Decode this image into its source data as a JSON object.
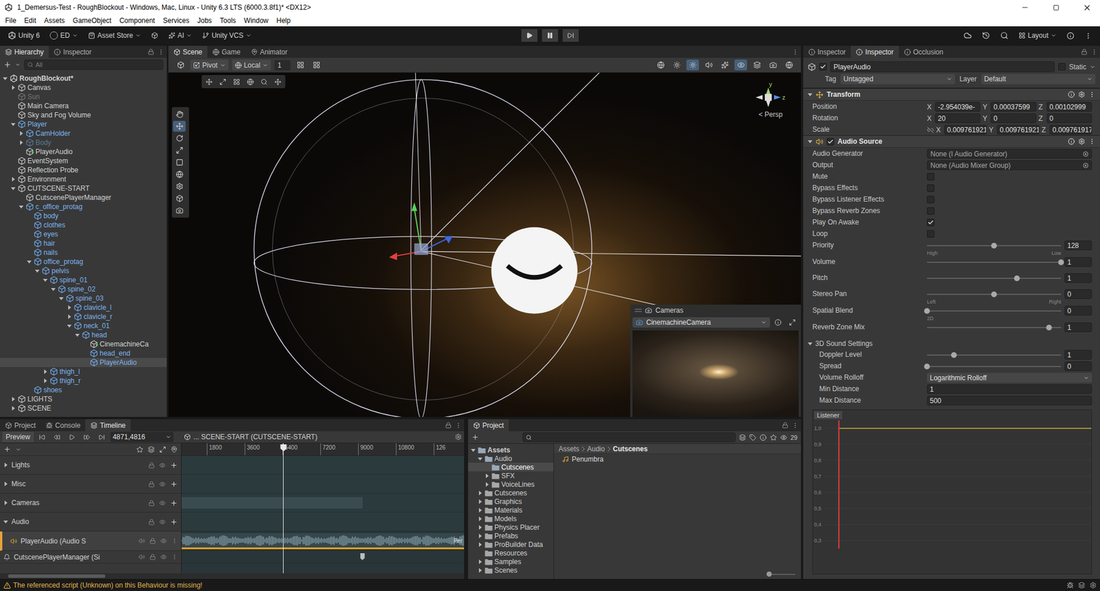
{
  "window": {
    "title": "1_Demersus-Test - RoughBlockout - Windows, Mac, Linux - Unity 6.3 LTS (6000.3.8f1)* <DX12>"
  },
  "menu": [
    "File",
    "Edit",
    "Assets",
    "GameObject",
    "Component",
    "Services",
    "Jobs",
    "Tools",
    "Window",
    "Help"
  ],
  "toolbar": {
    "account": "Unity 6",
    "user": "ED",
    "asset_store": "Asset Store",
    "ai": "AI",
    "vcs": "Unity VCS",
    "layout": "Layout",
    "playing": false,
    "paused": false
  },
  "hierarchy": {
    "tabs": [
      {
        "label": "Hierarchy",
        "selected": true
      },
      {
        "label": "Inspector",
        "selected": false
      }
    ],
    "search": {
      "placeholder": "All"
    },
    "rows": [
      {
        "label": "RoughBlockout*",
        "depth": 0,
        "kind": "scene",
        "has_children": true,
        "expanded": true,
        "selected": false,
        "disabled": false
      },
      {
        "label": "Canvas",
        "depth": 1,
        "kind": "object",
        "has_children": true,
        "expanded": false,
        "selected": false,
        "disabled": false
      },
      {
        "label": "Sun",
        "depth": 1,
        "kind": "object",
        "has_children": false,
        "expanded": false,
        "selected": false,
        "disabled": true
      },
      {
        "label": "Main Camera",
        "depth": 1,
        "kind": "object",
        "has_children": false,
        "expanded": false,
        "selected": false,
        "disabled": false
      },
      {
        "label": "Sky and Fog Volume",
        "depth": 1,
        "kind": "object",
        "has_children": false,
        "expanded": false,
        "selected": false,
        "disabled": false
      },
      {
        "label": "Player",
        "depth": 1,
        "kind": "prefab",
        "has_children": true,
        "expanded": true,
        "selected": false,
        "disabled": false
      },
      {
        "label": "CamHolder",
        "depth": 2,
        "kind": "prefab",
        "has_children": true,
        "expanded": false,
        "selected": false,
        "disabled": false
      },
      {
        "label": "Body",
        "depth": 2,
        "kind": "prefab",
        "has_children": true,
        "expanded": false,
        "selected": false,
        "disabled": true
      },
      {
        "label": "PlayerAudio",
        "depth": 2,
        "kind": "added",
        "has_children": false,
        "expanded": false,
        "selected": false,
        "disabled": false
      },
      {
        "label": "EventSystem",
        "depth": 1,
        "kind": "object",
        "has_children": false,
        "expanded": false,
        "selected": false,
        "disabled": false
      },
      {
        "label": "Reflection Probe",
        "depth": 1,
        "kind": "object",
        "has_children": false,
        "expanded": false,
        "selected": false,
        "disabled": false
      },
      {
        "label": "Environment",
        "depth": 1,
        "kind": "object",
        "has_children": true,
        "expanded": false,
        "selected": false,
        "disabled": false
      },
      {
        "label": "CUTSCENE-START",
        "depth": 1,
        "kind": "object",
        "has_children": true,
        "expanded": true,
        "selected": false,
        "disabled": false
      },
      {
        "label": "CutscenePlayerManager",
        "depth": 2,
        "kind": "object",
        "has_children": false,
        "expanded": false,
        "selected": false,
        "disabled": false
      },
      {
        "label": "c_office_protag",
        "depth": 2,
        "kind": "prefab",
        "has_children": true,
        "expanded": true,
        "selected": false,
        "disabled": false
      },
      {
        "label": "body",
        "depth": 3,
        "kind": "prefab",
        "has_children": false,
        "expanded": false,
        "selected": false,
        "disabled": false
      },
      {
        "label": "clothes",
        "depth": 3,
        "kind": "prefab",
        "has_children": false,
        "expanded": false,
        "selected": false,
        "disabled": false
      },
      {
        "label": "eyes",
        "depth": 3,
        "kind": "prefab",
        "has_children": false,
        "expanded": false,
        "selected": false,
        "disabled": false
      },
      {
        "label": "hair",
        "depth": 3,
        "kind": "prefab",
        "has_children": false,
        "expanded": false,
        "selected": false,
        "disabled": false
      },
      {
        "label": "nails",
        "depth": 3,
        "kind": "prefab",
        "has_children": false,
        "expanded": false,
        "selected": false,
        "disabled": false
      },
      {
        "label": "office_protag",
        "depth": 3,
        "kind": "prefab",
        "has_children": true,
        "expanded": true,
        "selected": false,
        "disabled": false
      },
      {
        "label": "pelvis",
        "depth": 4,
        "kind": "prefab",
        "has_children": true,
        "expanded": true,
        "selected": false,
        "disabled": false
      },
      {
        "label": "spine_01",
        "depth": 5,
        "kind": "prefab",
        "has_children": true,
        "expanded": true,
        "selected": false,
        "disabled": false
      },
      {
        "label": "spine_02",
        "depth": 6,
        "kind": "prefab",
        "has_children": true,
        "expanded": true,
        "selected": false,
        "disabled": false
      },
      {
        "label": "spine_03",
        "depth": 7,
        "kind": "prefab",
        "has_children": true,
        "expanded": true,
        "selected": false,
        "disabled": false
      },
      {
        "label": "clavicle_l",
        "depth": 8,
        "kind": "prefab",
        "has_children": true,
        "expanded": false,
        "selected": false,
        "disabled": false
      },
      {
        "label": "clavicle_r",
        "depth": 8,
        "kind": "prefab",
        "has_children": true,
        "expanded": false,
        "selected": false,
        "disabled": false
      },
      {
        "label": "neck_01",
        "depth": 8,
        "kind": "prefab",
        "has_children": true,
        "expanded": true,
        "selected": false,
        "disabled": false
      },
      {
        "label": "head",
        "depth": 9,
        "kind": "prefab",
        "has_children": true,
        "expanded": true,
        "selected": false,
        "disabled": false
      },
      {
        "label": "CinemachineCa",
        "depth": 10,
        "kind": "added",
        "has_children": false,
        "expanded": false,
        "selected": false,
        "disabled": false
      },
      {
        "label": "head_end",
        "depth": 10,
        "kind": "prefab",
        "has_children": false,
        "expanded": false,
        "selected": false,
        "disabled": false
      },
      {
        "label": "PlayerAudio",
        "depth": 10,
        "kind": "prefab",
        "has_children": false,
        "expanded": false,
        "selected": true,
        "disabled": false
      },
      {
        "label": "thigh_l",
        "depth": 5,
        "kind": "prefab",
        "has_children": true,
        "expanded": false,
        "selected": false,
        "disabled": false
      },
      {
        "label": "thigh_r",
        "depth": 5,
        "kind": "prefab",
        "has_children": true,
        "expanded": false,
        "selected": false,
        "disabled": false
      },
      {
        "label": "shoes",
        "depth": 3,
        "kind": "prefab",
        "has_children": false,
        "expanded": false,
        "selected": false,
        "disabled": false
      },
      {
        "label": "LIGHTS",
        "depth": 1,
        "kind": "object",
        "has_children": true,
        "expanded": false,
        "selected": false,
        "disabled": false
      },
      {
        "label": "SCENE",
        "depth": 1,
        "kind": "object",
        "has_children": true,
        "expanded": false,
        "selected": false,
        "disabled": false
      }
    ]
  },
  "scene": {
    "tabs": [
      {
        "label": "Scene",
        "selected": true
      },
      {
        "label": "Game",
        "selected": false
      },
      {
        "label": "Animator",
        "selected": false
      }
    ],
    "pivot": "Pivot",
    "space": "Local",
    "grid": "1",
    "axes": [
      "y",
      "z"
    ],
    "projection": "< Persp",
    "cameras_overlay": {
      "title": "Cameras",
      "camera": "CinemachineCamera"
    }
  },
  "inspector": {
    "tabs": [
      {
        "label": "Inspector",
        "selected": false
      },
      {
        "label": "Inspector",
        "selected": true
      },
      {
        "label": "Occlusion",
        "selected": false
      }
    ],
    "object": {
      "name": "PlayerAudio",
      "active": true,
      "static_label": "Static",
      "static": false,
      "tag_label": "Tag",
      "tag": "Untagged",
      "layer_label": "Layer",
      "layer": "Default"
    },
    "transform": {
      "title": "Transform",
      "expanded": true,
      "axes": [
        "X",
        "Y",
        "Z"
      ],
      "rows": [
        {
          "label": "Position",
          "x": "-2.954039e-",
          "y": "0.00037599",
          "z": "0.00102999"
        },
        {
          "label": "Rotation",
          "x": "20",
          "y": "0",
          "z": "0"
        },
        {
          "label": "Scale",
          "constrained": false,
          "x": "0.009761921",
          "y": "0.009761921",
          "z": "0.009761917"
        }
      ]
    },
    "audio_source": {
      "title": "Audio Source",
      "enabled": true,
      "expanded": true,
      "props": [
        {
          "kind": "object",
          "label": "Audio Generator",
          "value": "None (I Audio Generator)"
        },
        {
          "kind": "object",
          "label": "Output",
          "value": "None (Audio Mixer Group)"
        },
        {
          "kind": "checkbox",
          "label": "Mute",
          "checked": false
        },
        {
          "kind": "checkbox",
          "label": "Bypass Effects",
          "checked": false
        },
        {
          "kind": "checkbox",
          "label": "Bypass Listener Effects",
          "checked": false
        },
        {
          "kind": "checkbox",
          "label": "Bypass Reverb Zones",
          "checked": false
        },
        {
          "kind": "checkbox",
          "label": "Play On Awake",
          "checked": true
        },
        {
          "kind": "checkbox",
          "label": "Loop",
          "checked": false
        },
        {
          "kind": "slider",
          "label": "Priority",
          "level": 0.5,
          "value": "128",
          "min_label": "High",
          "max_label": "Low"
        },
        {
          "kind": "slider",
          "label": "Volume",
          "level": 1,
          "value": "1"
        },
        {
          "kind": "slider",
          "label": "Pitch",
          "level": 0.67,
          "value": "1"
        },
        {
          "kind": "slider",
          "label": "Stereo Pan",
          "level": 0.5,
          "value": "0",
          "min_label": "Left",
          "max_label": "Right"
        },
        {
          "kind": "slider",
          "label": "Spatial Blend",
          "level": 0,
          "value": "0",
          "min_label": "2D"
        },
        {
          "kind": "slider",
          "label": "Reverb Zone Mix",
          "level": 0.91,
          "value": "1"
        },
        {
          "kind": "section",
          "label": "3D Sound Settings",
          "expanded": true
        },
        {
          "kind": "slider",
          "label": "Doppler Level",
          "level": 0.2,
          "value": "1"
        },
        {
          "kind": "slider",
          "label": "Spread",
          "level": 0,
          "value": "0"
        },
        {
          "kind": "dropdown",
          "label": "Volume Rolloff",
          "value": "Logarithmic Rolloff"
        },
        {
          "kind": "number",
          "label": "Min Distance",
          "value": "1"
        },
        {
          "kind": "number",
          "label": "Max Distance",
          "value": "500"
        }
      ]
    },
    "graph": {
      "label": "Listener",
      "ticks": [
        "1,0",
        "0,9",
        "0,8",
        "0,7",
        "0,6",
        "0,5",
        "0,4",
        "0,3"
      ],
      "series": [
        {
          "name": "Volume",
          "color": "#c9b23a",
          "values": [
            1,
            1,
            1,
            1,
            1,
            1
          ]
        }
      ],
      "listener": 0.05
    }
  },
  "timeline": {
    "tabs": [
      {
        "label": "Project",
        "selected": false
      },
      {
        "label": "Console",
        "selected": false
      },
      {
        "label": "Timeline",
        "selected": true
      }
    ],
    "preview": "Preview",
    "frame": "4871,4816",
    "breadcrumb": "... SCENE-START (CUTSCENE-START)",
    "ruler": [
      "1800",
      "3600",
      "5400",
      "7200",
      "9000",
      "10800",
      "126"
    ],
    "playhead": 0.36,
    "tracks": [
      {
        "label": "Lights",
        "kind": "group",
        "expanded": false
      },
      {
        "label": "Misc",
        "kind": "group",
        "expanded": false
      },
      {
        "label": "Cameras",
        "kind": "group",
        "expanded": false,
        "level": 0.64
      },
      {
        "label": "Audio",
        "kind": "group",
        "expanded": true
      },
      {
        "label": "PlayerAudio (Audio S",
        "kind": "audio",
        "clip": "Per",
        "selected": true
      },
      {
        "label": "CutscenePlayerManager (Si",
        "kind": "signal",
        "marker": 0.64
      }
    ]
  },
  "project": {
    "tab": "Project",
    "count": "29",
    "tree": [
      {
        "label": "Assets",
        "depth": 0,
        "has_children": true,
        "expanded": true,
        "selected": false
      },
      {
        "label": "Audio",
        "depth": 1,
        "has_children": true,
        "expanded": true,
        "selected": false
      },
      {
        "label": "Cutscenes",
        "depth": 2,
        "has_children": false,
        "expanded": false,
        "selected": true
      },
      {
        "label": "SFX",
        "depth": 2,
        "has_children": true,
        "expanded": false,
        "selected": false
      },
      {
        "label": "VoiceLines",
        "depth": 2,
        "has_children": true,
        "expanded": false,
        "selected": false
      },
      {
        "label": "Cutscenes",
        "depth": 1,
        "has_children": true,
        "expanded": false,
        "selected": false
      },
      {
        "label": "Graphics",
        "depth": 1,
        "has_children": true,
        "expanded": false,
        "selected": false
      },
      {
        "label": "Materials",
        "depth": 1,
        "has_children": true,
        "expanded": false,
        "selected": false
      },
      {
        "label": "Models",
        "depth": 1,
        "has_children": true,
        "expanded": false,
        "selected": false
      },
      {
        "label": "Physics Placer",
        "depth": 1,
        "has_children": true,
        "expanded": false,
        "selected": false
      },
      {
        "label": "Prefabs",
        "depth": 1,
        "has_children": true,
        "expanded": false,
        "selected": false
      },
      {
        "label": "ProBuilder Data",
        "depth": 1,
        "has_children": true,
        "expanded": false,
        "selected": false
      },
      {
        "label": "Resources",
        "depth": 1,
        "has_children": false,
        "expanded": false,
        "selected": false
      },
      {
        "label": "Samples",
        "depth": 1,
        "has_children": true,
        "expanded": false,
        "selected": false
      },
      {
        "label": "Scenes",
        "depth": 1,
        "has_children": true,
        "expanded": false,
        "selected": false
      }
    ],
    "breadcrumb": [
      "Assets",
      "Audio",
      "Cutscenes"
    ],
    "items": [
      {
        "label": "Penumbra"
      }
    ]
  },
  "status_bar": {
    "message": "The referenced script (Unknown) on this Behaviour is missing!"
  }
}
